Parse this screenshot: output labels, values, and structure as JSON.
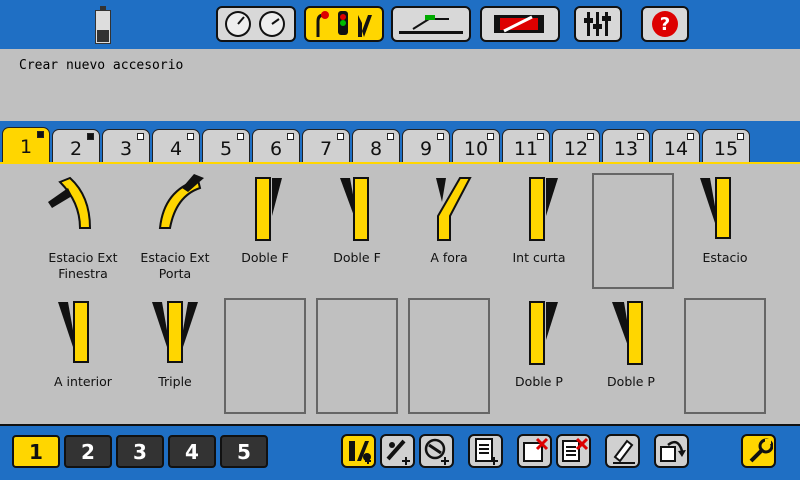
{
  "status": {
    "message": "Crear nuevo accesorio"
  },
  "top_toolbar": [
    {
      "icon": "speedometer-icon"
    },
    {
      "icon": "signals-turnouts-icon",
      "active": true
    },
    {
      "icon": "track-layout-icon"
    },
    {
      "icon": "locomotive-tools-icon"
    },
    {
      "icon": "sliders-icon"
    },
    {
      "icon": "help-icon"
    }
  ],
  "tabs": [
    {
      "label": "1",
      "active": true,
      "filled": true
    },
    {
      "label": "2",
      "filled": true
    },
    {
      "label": "3"
    },
    {
      "label": "4"
    },
    {
      "label": "5"
    },
    {
      "label": "6"
    },
    {
      "label": "7"
    },
    {
      "label": "8"
    },
    {
      "label": "9"
    },
    {
      "label": "10"
    },
    {
      "label": "11"
    },
    {
      "label": "12"
    },
    {
      "label": "13"
    },
    {
      "label": "14"
    },
    {
      "label": "15"
    }
  ],
  "accessories": {
    "row1": [
      {
        "label1": "Estacio Ext",
        "label2": "Finestra",
        "icon": "curved-turnout-right-icon"
      },
      {
        "label1": "Estacio Ext",
        "label2": "Porta",
        "icon": "curved-turnout-left-icon"
      },
      {
        "label1": "Doble F",
        "label2": "",
        "icon": "double-turnout-icon"
      },
      {
        "label1": "Doble F",
        "label2": "",
        "icon": "double-turnout-icon"
      },
      {
        "label1": "A fora",
        "label2": "",
        "icon": "turnout-icon"
      },
      {
        "label1": "Int curta",
        "label2": "",
        "icon": "turnout-icon"
      },
      {
        "label1": "Estacio",
        "label2": "",
        "icon": "turnout-icon"
      }
    ],
    "row2": [
      {
        "label1": "A interior",
        "label2": "",
        "icon": "turnout-icon"
      },
      {
        "label1": "Triple",
        "label2": "",
        "icon": "three-way-turnout-icon"
      },
      {
        "label1": "Doble P",
        "label2": "",
        "icon": "double-turnout-icon"
      },
      {
        "label1": "Doble P",
        "label2": "",
        "icon": "double-turnout-icon"
      }
    ]
  },
  "pages": [
    {
      "label": "1",
      "active": true
    },
    {
      "label": "2"
    },
    {
      "label": "3"
    },
    {
      "label": "4"
    },
    {
      "label": "5"
    }
  ],
  "bottom_tools": [
    {
      "icon": "add-turnout-icon",
      "active": true
    },
    {
      "icon": "add-signal-icon"
    },
    {
      "icon": "add-decoupler-icon"
    },
    {
      "icon": "add-list-icon"
    },
    {
      "icon": "delete-accessory-icon"
    },
    {
      "icon": "delete-list-icon"
    },
    {
      "icon": "edit-icon"
    },
    {
      "icon": "move-icon"
    },
    {
      "icon": "settings-wrench-icon",
      "active": true
    }
  ],
  "colors": {
    "accent": "#ffd600",
    "background": "#1f6fc4",
    "panel": "#c0c0c0"
  }
}
